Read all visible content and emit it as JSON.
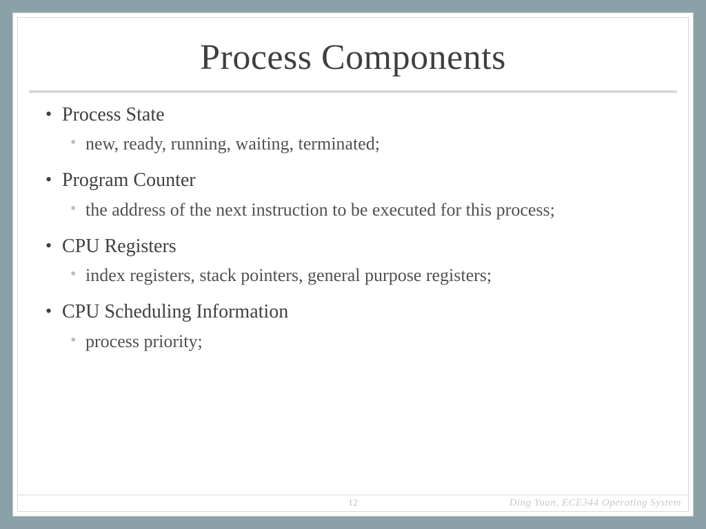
{
  "slide": {
    "title": "Process Components",
    "items": [
      {
        "label": "Process State",
        "sub": [
          "new, ready, running, waiting, terminated;"
        ]
      },
      {
        "label": "Program Counter",
        "sub": [
          "the address of the next instruction to be executed for this process;"
        ]
      },
      {
        "label": "CPU Registers",
        "sub": [
          "index registers, stack pointers, general purpose registers;"
        ]
      },
      {
        "label": "CPU Scheduling Information",
        "sub": [
          "process priority;"
        ]
      }
    ],
    "page_number": "12",
    "footer_author": "Ding Yuan, ECE344 Operating System"
  }
}
